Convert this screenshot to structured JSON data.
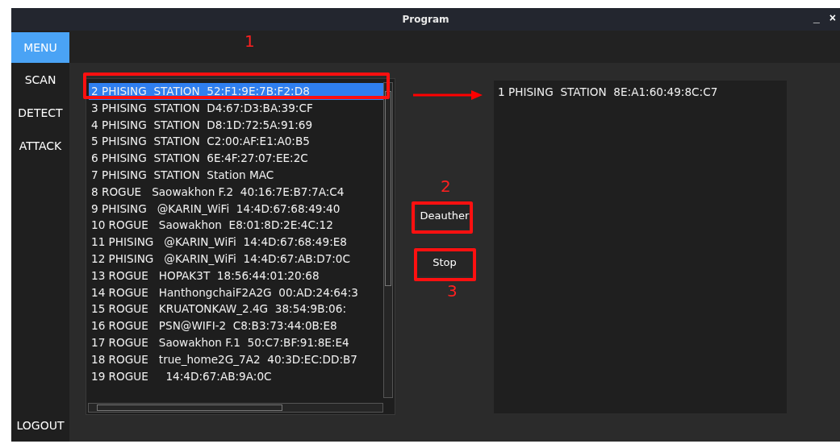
{
  "window": {
    "title": "Program",
    "controls": [
      "_",
      "×"
    ]
  },
  "sidebar": {
    "items": [
      {
        "label": "MENU",
        "selected": true
      },
      {
        "label": "SCAN",
        "selected": false
      },
      {
        "label": "DETECT",
        "selected": false
      },
      {
        "label": "ATTACK",
        "selected": false
      }
    ],
    "bottom_item": "LOGOUT"
  },
  "station_list": {
    "rows": [
      {
        "text": "2 PHISING  STATION  52:F1:9E:7B:F2:D8",
        "selected": true
      },
      {
        "text": "3 PHISING  STATION  D4:67:D3:BA:39:CF",
        "selected": false
      },
      {
        "text": "4 PHISING  STATION  D8:1D:72:5A:91:69",
        "selected": false
      },
      {
        "text": "5 PHISING  STATION  C2:00:AF:E1:A0:B5",
        "selected": false
      },
      {
        "text": "6 PHISING  STATION  6E:4F:27:07:EE:2C",
        "selected": false
      },
      {
        "text": "7 PHISING  STATION  Station MAC",
        "selected": false
      },
      {
        "text": "8 ROGUE   Saowakhon F.2  40:16:7E:B7:7A:C4",
        "selected": false
      },
      {
        "text": "9 PHISING   @KARIN_WiFi  14:4D:67:68:49:40",
        "selected": false
      },
      {
        "text": "10 ROGUE   Saowakhon  E8:01:8D:2E:4C:12",
        "selected": false
      },
      {
        "text": "11 PHISING   @KARIN_WiFi  14:4D:67:68:49:E8",
        "selected": false
      },
      {
        "text": "12 PHISING   @KARIN_WiFi  14:4D:67:AB:D7:0C",
        "selected": false
      },
      {
        "text": "13 ROGUE   HOPAK3T  18:56:44:01:20:68",
        "selected": false
      },
      {
        "text": "14 ROGUE   HanthongchaiF2A2G  00:AD:24:64:3",
        "selected": false
      },
      {
        "text": "15 ROGUE   KRUATONKAW_2.4G  38:54:9B:06:",
        "selected": false
      },
      {
        "text": "16 ROGUE   PSN@WIFI-2  C8:B3:73:44:0B:E8",
        "selected": false
      },
      {
        "text": "17 ROGUE   Saowakhon F.1  50:C7:BF:91:8E:E4",
        "selected": false
      },
      {
        "text": "18 ROGUE   true_home2G_7A2  40:3D:EC:DD:B7",
        "selected": false
      },
      {
        "text": "19 ROGUE     14:4D:67:AB:9A:0C",
        "selected": false
      }
    ]
  },
  "buttons": [
    "Deauther",
    "Stop"
  ],
  "target_list": {
    "rows": [
      {
        "text": "1 PHISING  STATION  8E:A1:60:49:8C:C7"
      }
    ]
  },
  "annotations": [
    {
      "label": "1"
    },
    {
      "label": "2"
    },
    {
      "label": "3"
    }
  ]
}
